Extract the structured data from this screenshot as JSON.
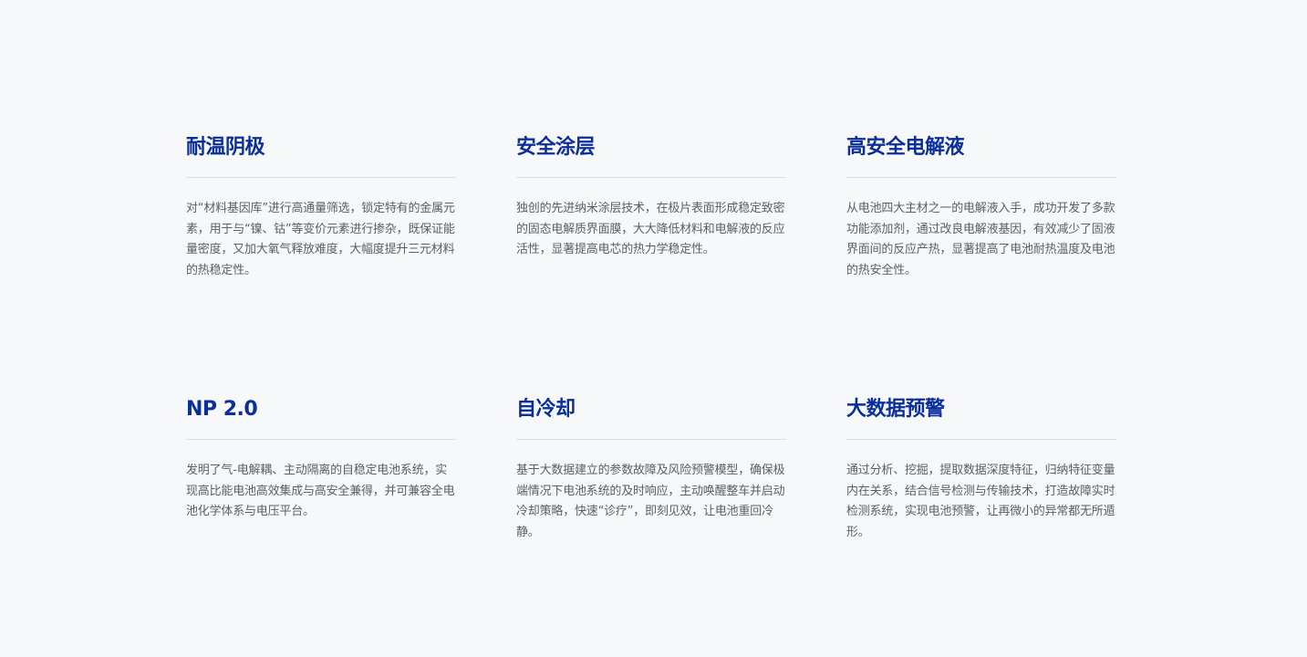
{
  "features": [
    {
      "title": "耐温阴极",
      "description": "对“材料基因库”进行高通量筛选，锁定特有的金属元素，用于与“镍、钴”等变价元素进行掺杂，既保证能量密度，又加大氧气释放难度，大幅度提升三元材料的热稳定性。"
    },
    {
      "title": "安全涂层",
      "description": "独创的先进纳米涂层技术，在极片表面形成稳定致密的固态电解质界面膜，大大降低材料和电解液的反应活性，显著提高电芯的热力学稳定性。"
    },
    {
      "title": "高安全电解液",
      "description": "从电池四大主材之一的电解液入手，成功开发了多款功能添加剂，通过改良电解液基因，有效减少了固液界面间的反应产热，显著提高了电池耐热温度及电池的热安全性。"
    },
    {
      "title": "NP 2.0",
      "description": "发明了气-电解耦、主动隔离的自稳定电池系统，实现高比能电池高效集成与高安全兼得，并可兼容全电池化学体系与电压平台。"
    },
    {
      "title": "自冷却",
      "description": "基于大数据建立的参数故障及风险预警模型，确保极端情况下电池系统的及时响应，主动唤醒整车并启动冷却策略，快速“诊疗”，即刻见效，让电池重回冷静。"
    },
    {
      "title": "大数据预警",
      "description": "通过分析、挖掘，提取数据深度特征，归纳特征变量内在关系，结合信号检测与传输技术，打造故障实时检测系统，实现电池预警，让再微小的异常都无所遁形。"
    }
  ],
  "colors": {
    "background": "#f7f8fa",
    "title": "#0a2e9c",
    "text": "#5a5f66",
    "divider": "#dcdfe4"
  }
}
